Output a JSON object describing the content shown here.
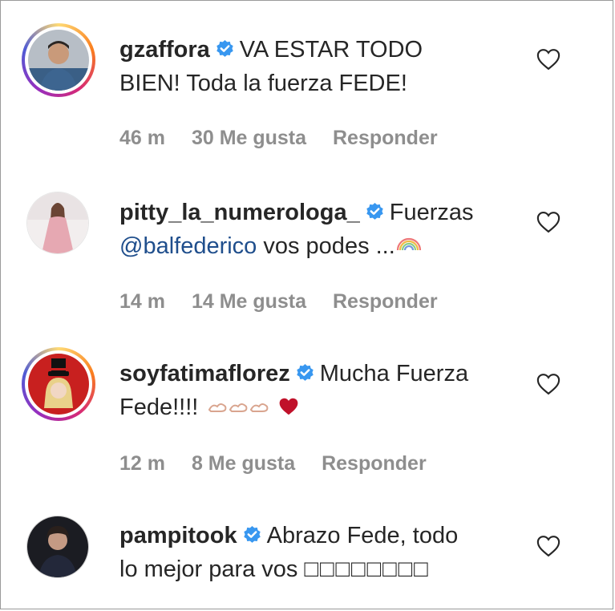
{
  "comments": [
    {
      "username": "gzaffora",
      "text": "VA ESTAR TODO BIEN! Toda la fuerza FEDE!",
      "line1": "VA ESTAR TODO",
      "line2": "BIEN! Toda la fuerza FEDE!",
      "time": "46 m",
      "likes": "30 Me gusta",
      "reply": "Responder",
      "avatar_icon": "profile-photo-man-icon",
      "story_ring": true
    },
    {
      "username": "pitty_la_numerologa_",
      "line1": "Fuerzas",
      "mention": "@balfederico",
      "line2_rest": " vos podes ...",
      "emoji": "rainbow-icon",
      "time": "14 m",
      "likes": "14 Me gusta",
      "reply": "Responder",
      "avatar_icon": "profile-photo-woman-pink-dress-icon",
      "story_ring": false
    },
    {
      "username": "soyfatimaflorez",
      "line1": "Mucha Fuerza",
      "line2": "Fede!!!!",
      "emoji": "muscle-muscle-muscle-red-heart",
      "time": "12 m",
      "likes": "8 Me gusta",
      "reply": "Responder",
      "avatar_icon": "profile-photo-woman-top-hat-icon",
      "story_ring": true
    },
    {
      "username": "pampitook",
      "line1": "Abrazo Fede, todo",
      "line2": "lo mejor para vos",
      "boxes": "□□□□□□□□",
      "avatar_icon": "profile-photo-woman-dark-icon",
      "story_ring": false
    }
  ],
  "colors": {
    "text": "#262626",
    "meta": "#8e8e8e",
    "verified": "#3897f0",
    "mention": "#1f4e8c",
    "heart": "#262626",
    "red_heart": "#c0112a"
  }
}
